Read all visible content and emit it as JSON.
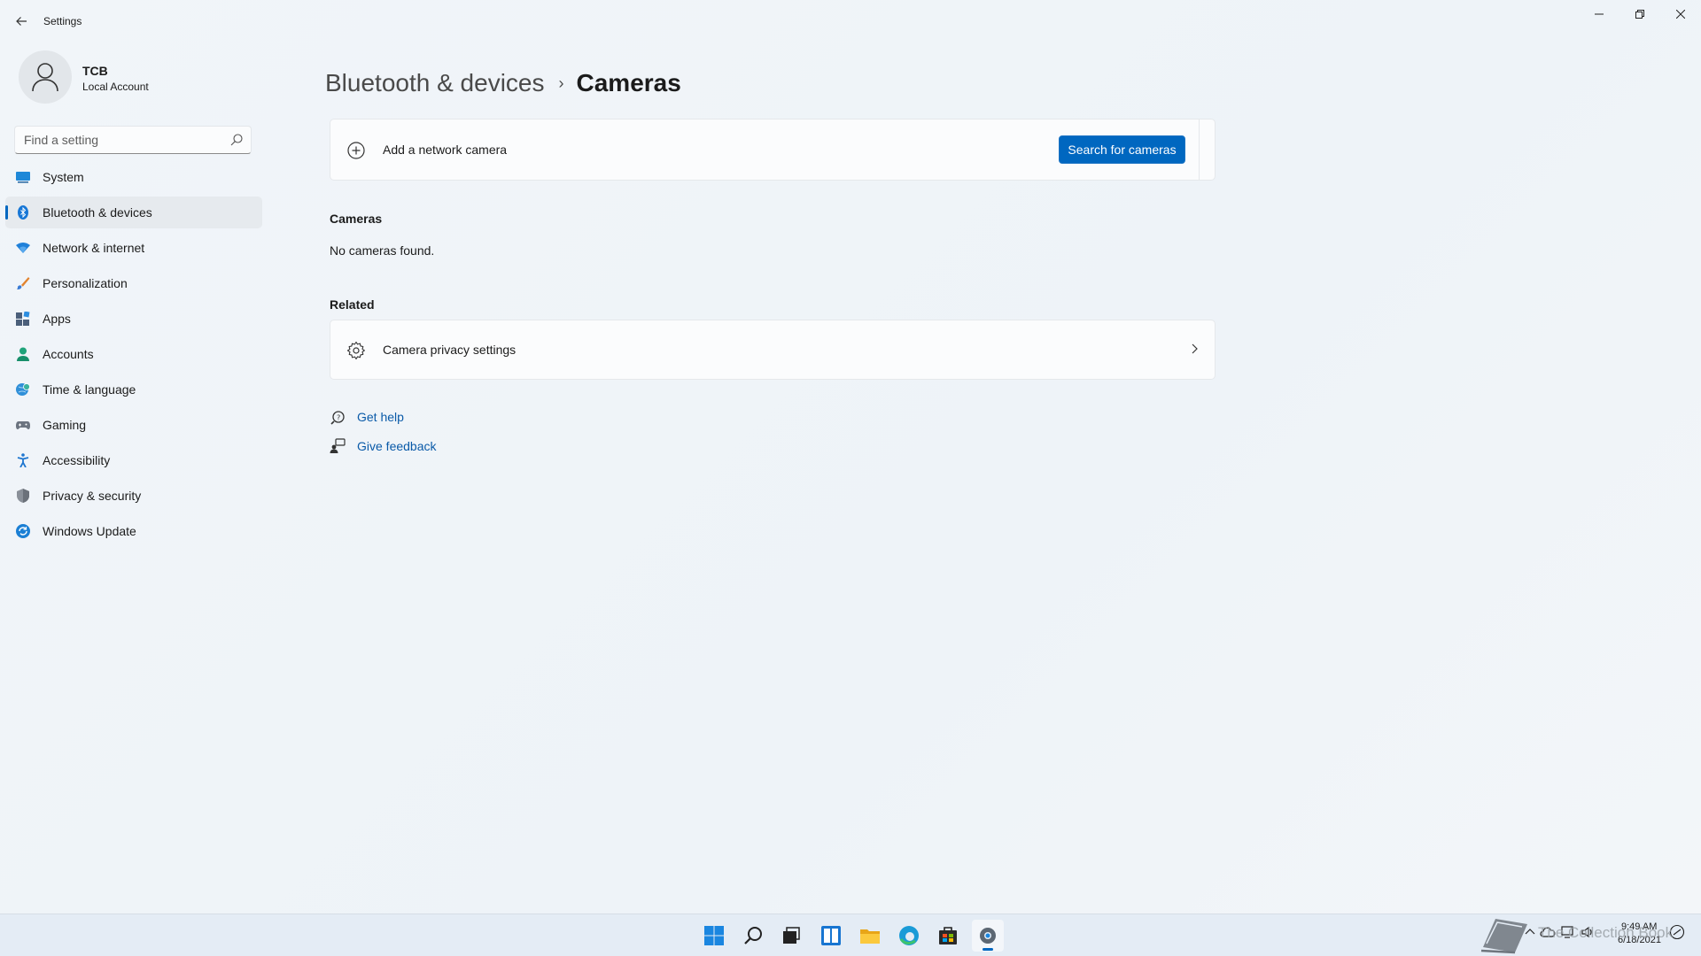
{
  "window": {
    "app_title": "Settings",
    "controls": {
      "minimize": "—",
      "maximize": "❐",
      "close": "✕"
    }
  },
  "profile": {
    "name": "TCB",
    "account_type": "Local Account"
  },
  "search": {
    "placeholder": "Find a setting"
  },
  "nav": {
    "items": [
      {
        "label": "System",
        "icon": "system-icon",
        "active": false
      },
      {
        "label": "Bluetooth & devices",
        "icon": "bluetooth-icon",
        "active": true
      },
      {
        "label": "Network & internet",
        "icon": "wifi-icon",
        "active": false
      },
      {
        "label": "Personalization",
        "icon": "brush-icon",
        "active": false
      },
      {
        "label": "Apps",
        "icon": "apps-icon",
        "active": false
      },
      {
        "label": "Accounts",
        "icon": "person-icon",
        "active": false
      },
      {
        "label": "Time & language",
        "icon": "globe-clock-icon",
        "active": false
      },
      {
        "label": "Gaming",
        "icon": "gamepad-icon",
        "active": false
      },
      {
        "label": "Accessibility",
        "icon": "accessibility-icon",
        "active": false
      },
      {
        "label": "Privacy & security",
        "icon": "shield-icon",
        "active": false
      },
      {
        "label": "Windows Update",
        "icon": "update-icon",
        "active": false
      }
    ]
  },
  "breadcrumb": {
    "parent": "Bluetooth & devices",
    "separator": "›",
    "current": "Cameras"
  },
  "add_camera": {
    "label": "Add a network camera",
    "button": "Search for cameras"
  },
  "cameras": {
    "title": "Cameras",
    "empty": "No cameras found."
  },
  "related": {
    "title": "Related",
    "privacy_label": "Camera privacy settings"
  },
  "help": {
    "get_help": "Get help",
    "give_feedback": "Give feedback"
  },
  "tray": {
    "time": "9:49 AM",
    "date": "6/18/2021"
  },
  "watermark": {
    "text": "The Collection Book"
  },
  "colors": {
    "accent": "#0067c0",
    "link": "#0a5aa8"
  }
}
